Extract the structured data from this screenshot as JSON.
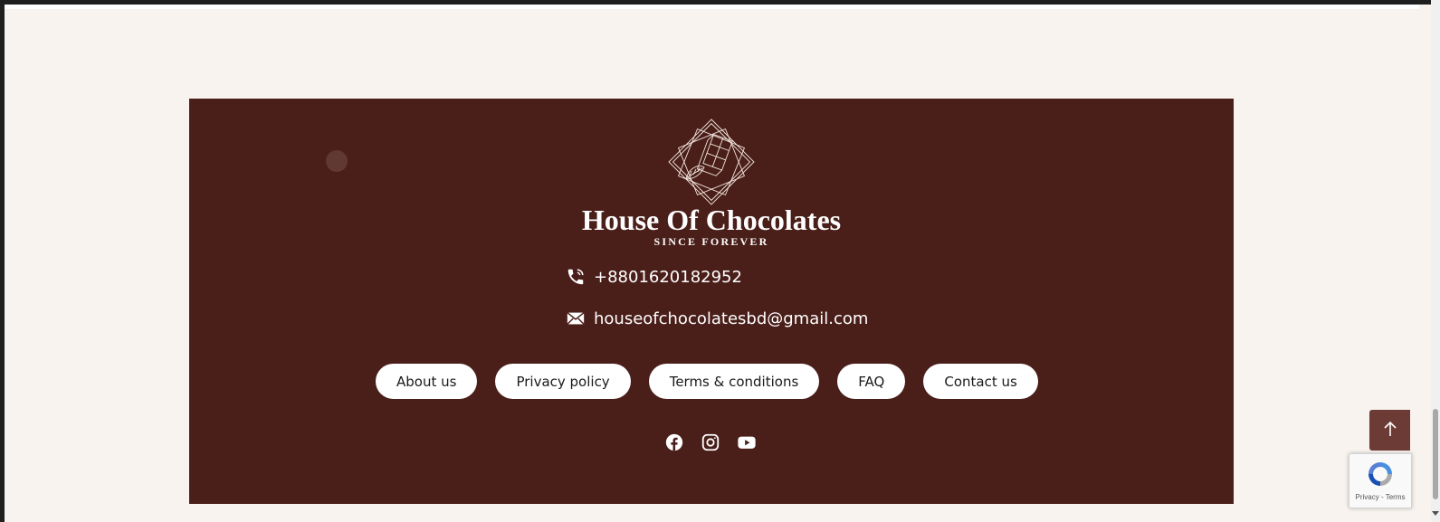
{
  "brand": {
    "name": "House Of Chocolates",
    "tagline": "SINCE FOREVER",
    "logo_icon": "chocolate-emblem-icon"
  },
  "contact": {
    "phone": "+8801620182952",
    "phone_icon": "phone-icon",
    "email": "houseofchocolatesbd@gmail.com",
    "email_icon": "envelope-icon"
  },
  "footer_links": [
    {
      "label": "About us"
    },
    {
      "label": "Privacy policy"
    },
    {
      "label": "Terms & conditions"
    },
    {
      "label": "FAQ"
    },
    {
      "label": "Contact us"
    }
  ],
  "socials": [
    {
      "icon": "facebook-icon"
    },
    {
      "icon": "instagram-icon"
    },
    {
      "icon": "youtube-icon"
    }
  ],
  "back_to_top_icon": "arrow-up-icon",
  "recaptcha": {
    "links": "Privacy - Terms"
  },
  "colors": {
    "page_background": "#f8f3ee",
    "footer_background": "#4a1e19",
    "back_to_top": "#6d3b35",
    "pill_background": "#ffffff"
  }
}
